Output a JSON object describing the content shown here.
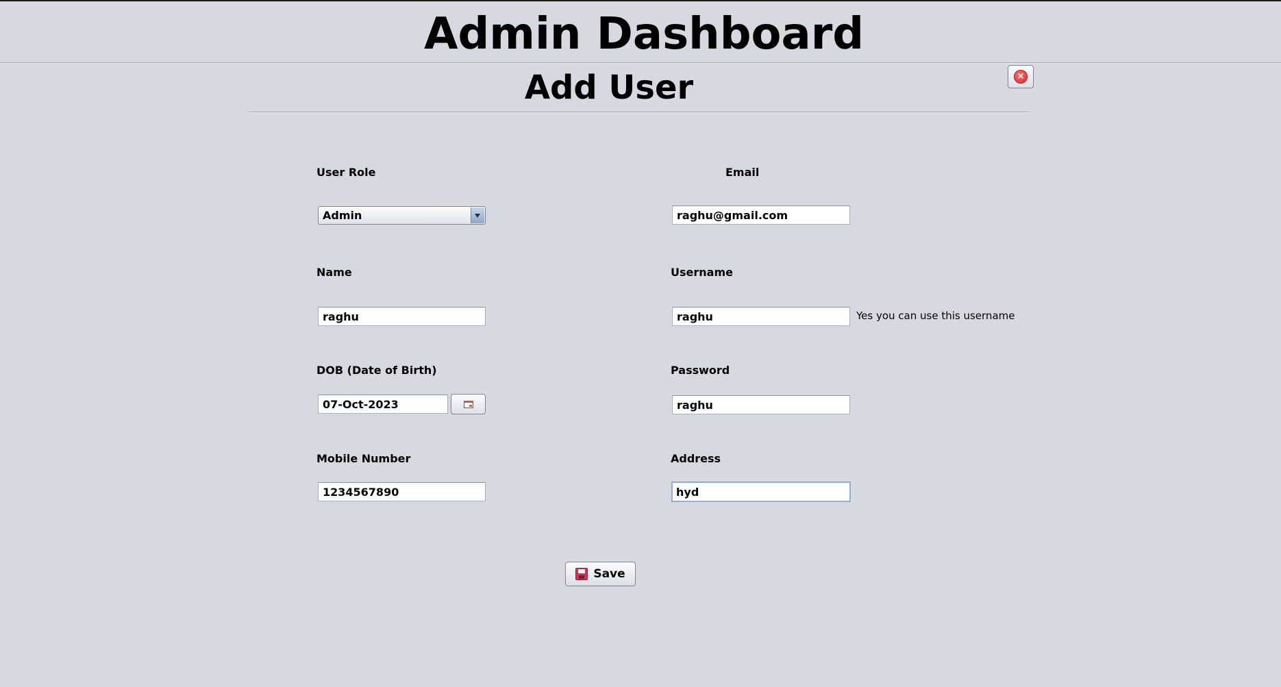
{
  "app": {
    "title": "Admin Dashboard"
  },
  "panel": {
    "title": "Add User"
  },
  "form": {
    "user_role": {
      "label": "User Role",
      "value": "Admin"
    },
    "email": {
      "label": "Email",
      "value": "raghu@gmail.com"
    },
    "name": {
      "label": "Name",
      "value": "raghu"
    },
    "username": {
      "label": "Username",
      "value": "raghu",
      "availability": "Yes you can use this username"
    },
    "dob": {
      "label": "DOB (Date of Birth)",
      "value": "07-Oct-2023"
    },
    "password": {
      "label": "Password",
      "value": "raghu"
    },
    "mobile": {
      "label": "Mobile Number",
      "value": "1234567890"
    },
    "address": {
      "label": "Address",
      "value": "hyd"
    }
  },
  "actions": {
    "save_label": "Save"
  },
  "icons": {
    "close": "close-icon",
    "dropdown": "chevron-down-icon",
    "calendar": "calendar-icon",
    "save": "floppy-disk-icon"
  },
  "colors": {
    "background": "#d6d9e0",
    "close_red": "#d42a2a",
    "focus_border": "#8eaed3"
  }
}
